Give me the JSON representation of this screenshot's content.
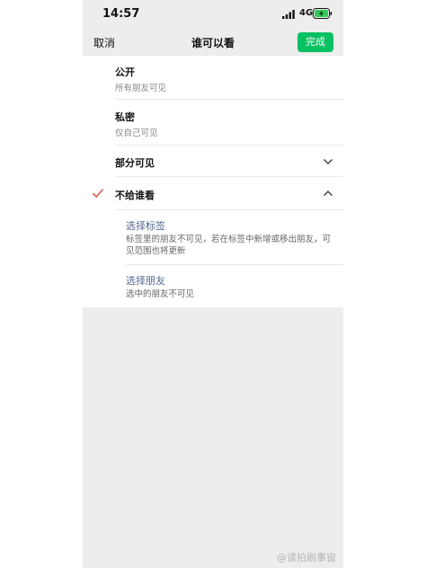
{
  "status_bar": {
    "time": "14:57",
    "network": "4G",
    "icons": [
      "signal-icon",
      "battery-charging-icon"
    ]
  },
  "nav": {
    "cancel_label": "取消",
    "title": "谁可以看",
    "done_label": "完成",
    "done_color": "#07c160"
  },
  "options": [
    {
      "title": "公开",
      "subtitle": "所有朋友可见"
    },
    {
      "title": "私密",
      "subtitle": "仅自己可见"
    },
    {
      "title": "部分可见",
      "icon": "chevron-down-icon"
    },
    {
      "title": "不给谁看",
      "icon": "chevron-up-icon",
      "selected": true,
      "check_icon": "checkmark-icon",
      "check_color": "#e0504a"
    }
  ],
  "sub_options": [
    {
      "title": "选择标签",
      "desc": "标签里的朋友不可见，若在标签中新增或移出朋友，可见范围也将更新"
    },
    {
      "title": "选择朋友",
      "desc": "选中的朋友不可见"
    }
  ],
  "watermark": "@读拍刷事窗"
}
